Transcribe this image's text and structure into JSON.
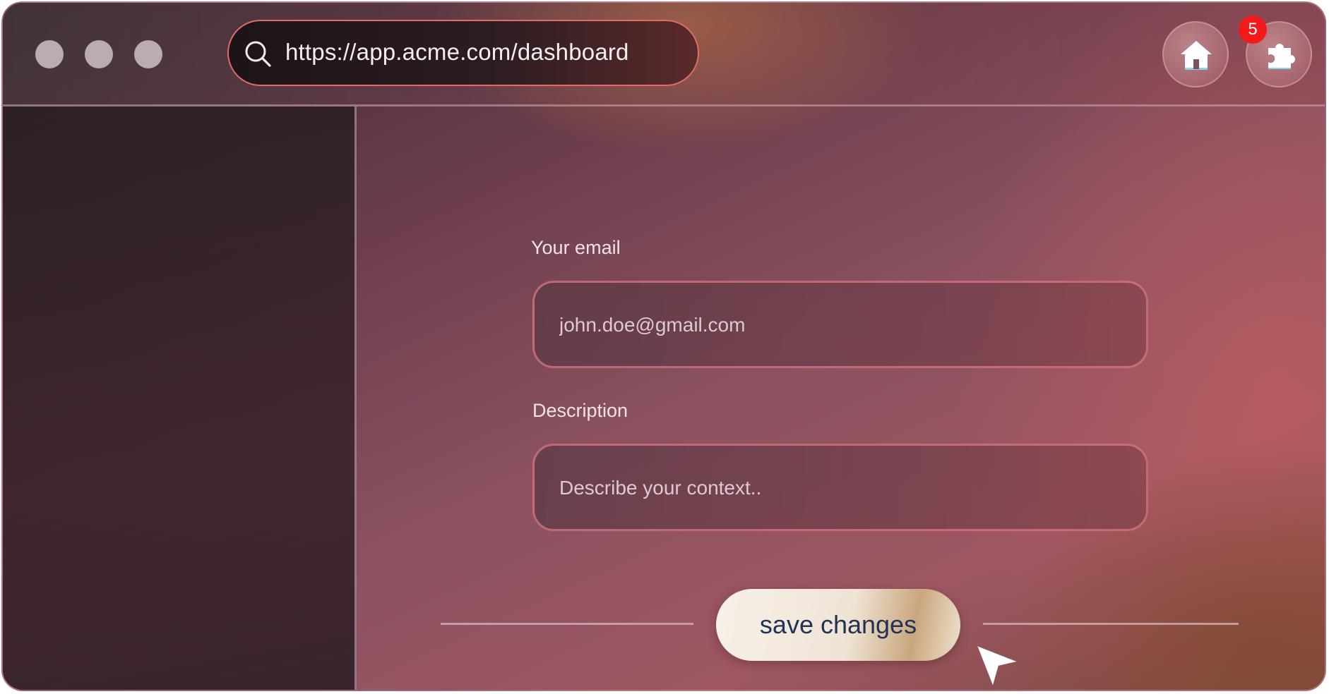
{
  "window": {
    "controls": [
      "close-dot",
      "minimize-dot",
      "maximize-dot"
    ]
  },
  "browser": {
    "url": "https://app.acme.com/dashboard",
    "search_icon": "search-icon",
    "home_icon": "home-icon",
    "extension_icon": "puzzle-piece-icon",
    "notification_count": "5"
  },
  "form": {
    "email_label": "Your email",
    "email_placeholder": "john.doe@gmail.com",
    "description_label": "Description",
    "description_placeholder": "Describe your context..",
    "save_label": "save changes"
  },
  "colors": {
    "url_bar_border": "#e46b67",
    "badge": "#f21a1a",
    "save_text": "#1f3454"
  }
}
